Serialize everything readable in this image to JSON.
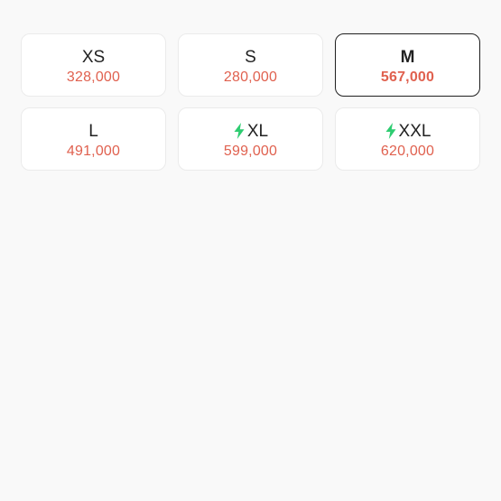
{
  "sizes": [
    {
      "label": "XS",
      "price": "328,000",
      "selected": false,
      "fast": false
    },
    {
      "label": "S",
      "price": "280,000",
      "selected": false,
      "fast": false
    },
    {
      "label": "M",
      "price": "567,000",
      "selected": true,
      "fast": false
    },
    {
      "label": "L",
      "price": "491,000",
      "selected": false,
      "fast": false
    },
    {
      "label": "XL",
      "price": "599,000",
      "selected": false,
      "fast": true
    },
    {
      "label": "XXL",
      "price": "620,000",
      "selected": false,
      "fast": true
    }
  ],
  "icons": {
    "fast_delivery": "lightning-bolt-icon"
  },
  "colors": {
    "price": "#e0614f",
    "bolt": "#2ecc71",
    "selected_border": "#1f1f1f",
    "card_border": "#ebebeb",
    "background": "#f9f9f9"
  }
}
